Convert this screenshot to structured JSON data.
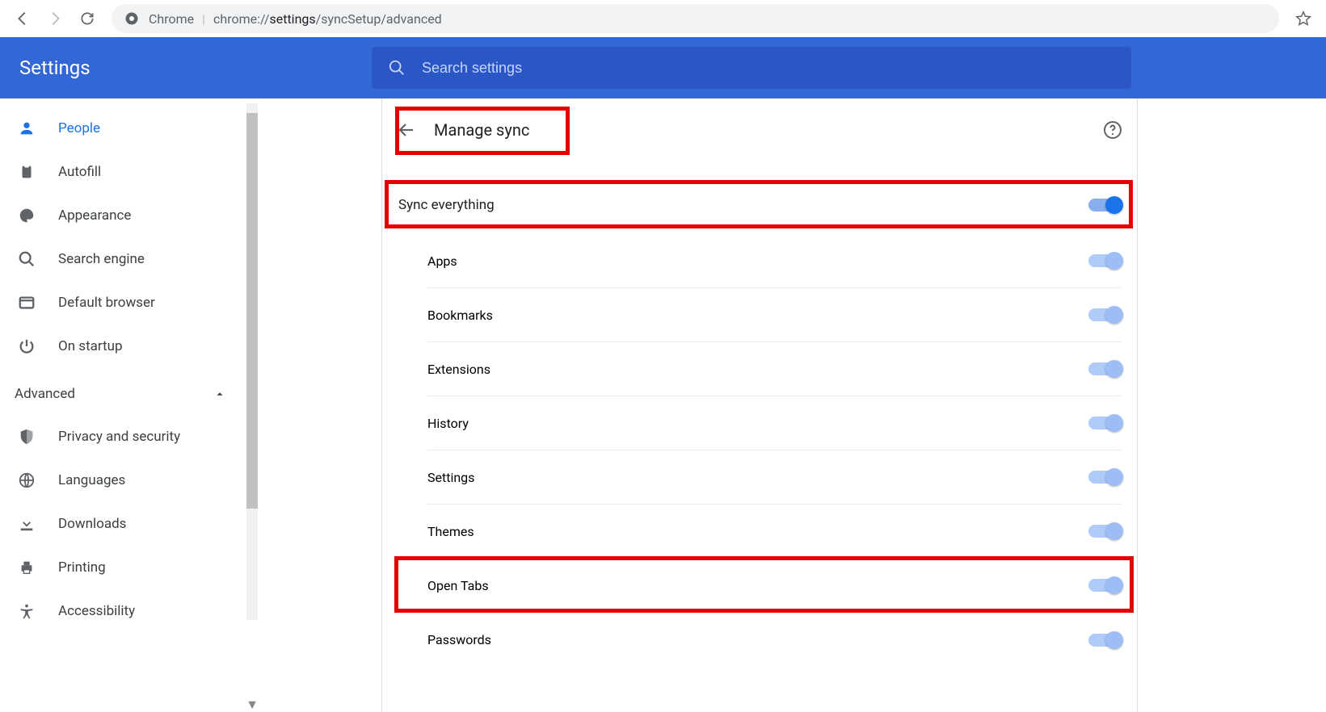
{
  "toolbar": {
    "url_prefix": "Chrome",
    "url_scheme": "chrome://",
    "url_host": "settings",
    "url_path": "/syncSetup/advanced"
  },
  "header": {
    "title": "Settings",
    "search_placeholder": "Search settings"
  },
  "sidebar": {
    "items": [
      {
        "label": "People",
        "icon": "person-icon",
        "active": true
      },
      {
        "label": "Autofill",
        "icon": "clipboard-icon",
        "active": false
      },
      {
        "label": "Appearance",
        "icon": "palette-icon",
        "active": false
      },
      {
        "label": "Search engine",
        "icon": "search-icon",
        "active": false
      },
      {
        "label": "Default browser",
        "icon": "browser-icon",
        "active": false
      },
      {
        "label": "On startup",
        "icon": "power-icon",
        "active": false
      }
    ],
    "advanced_label": "Advanced",
    "advanced_items": [
      {
        "label": "Privacy and security",
        "icon": "shield-icon"
      },
      {
        "label": "Languages",
        "icon": "globe-icon"
      },
      {
        "label": "Downloads",
        "icon": "download-icon"
      },
      {
        "label": "Printing",
        "icon": "printer-icon"
      },
      {
        "label": "Accessibility",
        "icon": "accessibility-icon"
      }
    ]
  },
  "main": {
    "section_title": "Manage sync",
    "primary_toggle": {
      "label": "Sync everything",
      "on": true,
      "active": true
    },
    "sub_toggles": [
      {
        "label": "Apps",
        "on": true
      },
      {
        "label": "Bookmarks",
        "on": true
      },
      {
        "label": "Extensions",
        "on": true
      },
      {
        "label": "History",
        "on": true
      },
      {
        "label": "Settings",
        "on": true
      },
      {
        "label": "Themes",
        "on": true
      },
      {
        "label": "Open Tabs",
        "on": true
      },
      {
        "label": "Passwords",
        "on": true
      }
    ]
  }
}
